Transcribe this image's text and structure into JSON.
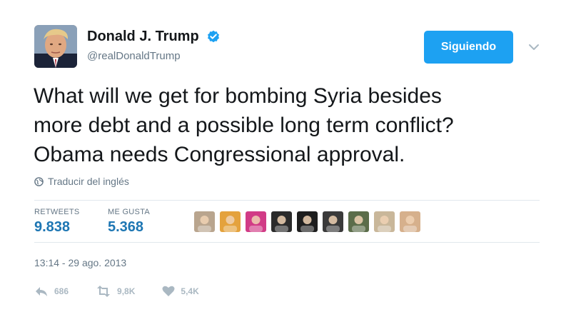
{
  "author": {
    "fullname": "Donald J. Trump",
    "username": "@realDonaldTrump",
    "verified": true
  },
  "follow_button": {
    "label": "Siguiendo",
    "color": "#1da1f2"
  },
  "tweet": {
    "lines": [
      "What will we get for bombing Syria besides",
      "more debt and a possible long term conflict?",
      "Obama needs Congressional approval."
    ]
  },
  "translate": {
    "label": "Traducir del inglés"
  },
  "stats": {
    "retweets_label": "RETWEETS",
    "retweets_value": "9.838",
    "likes_label": "ME GUSTA",
    "likes_value": "5.368"
  },
  "likers": [
    {
      "icon": "user-avatar",
      "color": "#b9a58e"
    },
    {
      "icon": "user-avatar",
      "color": "#e4a23d"
    },
    {
      "icon": "user-avatar",
      "color": "#d13b86"
    },
    {
      "icon": "user-avatar",
      "color": "#2b2b2b"
    },
    {
      "icon": "user-avatar",
      "color": "#1e1e1e"
    },
    {
      "icon": "user-avatar",
      "color": "#3a3a3a"
    },
    {
      "icon": "user-avatar",
      "color": "#5b6d4a"
    },
    {
      "icon": "user-avatar",
      "color": "#c9b79a"
    },
    {
      "icon": "user-avatar",
      "color": "#d6b08c"
    }
  ],
  "timestamp": "13:14 - 29 ago. 2013",
  "actions": {
    "reply_count": "686",
    "retweet_count": "9,8K",
    "like_count": "5,4K"
  },
  "colors": {
    "accent": "#1da1f2",
    "stat_value": "#1d76b3",
    "muted": "#657786",
    "action_gray": "#aab8c2"
  }
}
